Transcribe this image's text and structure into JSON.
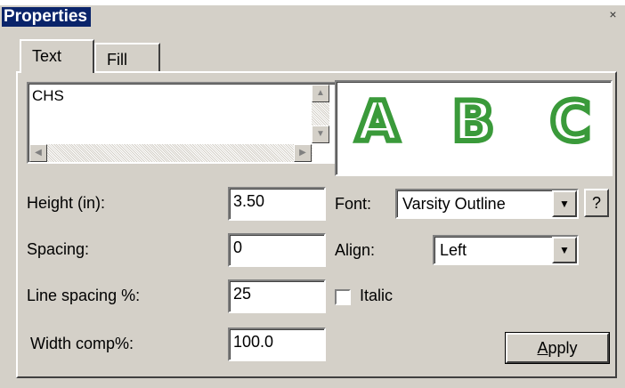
{
  "window": {
    "title": "Properties",
    "close_symbol": "×"
  },
  "tabs": [
    {
      "label": "Text",
      "active": true
    },
    {
      "label": "Fill",
      "active": false
    }
  ],
  "text_box": {
    "value": "CHS"
  },
  "preview": {
    "letters": [
      "A",
      "B",
      "C"
    ],
    "color": "#3a9a3a"
  },
  "fields": {
    "height": {
      "label": "Height (in):",
      "value": "3.50"
    },
    "spacing": {
      "label": "Spacing:",
      "value": "0"
    },
    "line_spacing": {
      "label": "Line spacing %:",
      "value": "25"
    },
    "width_comp": {
      "label": "Width comp%:",
      "value": "100.0"
    }
  },
  "font": {
    "label": "Font:",
    "value": "Varsity Outline",
    "help_label": "?"
  },
  "align": {
    "label": "Align:",
    "value": "Left"
  },
  "italic": {
    "label": "Italic",
    "checked": false
  },
  "apply_button": {
    "first_letter": "A",
    "rest": "pply"
  },
  "icons": {
    "scroll_up": "▲",
    "scroll_down": "▼",
    "scroll_left": "◀",
    "scroll_right": "▶",
    "dropdown_arrow": "▼"
  }
}
